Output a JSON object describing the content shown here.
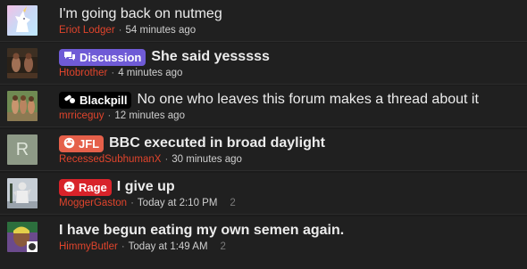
{
  "threads": [
    {
      "title": "I'm going back on nutmeg",
      "prefix": null,
      "author": "Eriot Lodger",
      "time": "54 minutes ago",
      "replies": null,
      "title_bold": false,
      "avatar_icon": "unicorn-avatar-icon"
    },
    {
      "title": "She said yesssss",
      "prefix": {
        "label": "Discussion",
        "icon": "chat-bubbles-icon",
        "color": "#6f5bd6"
      },
      "author": "Htobrother",
      "time": "4 minutes ago",
      "replies": null,
      "title_bold": true,
      "avatar_icon": "photo-avatar-icon"
    },
    {
      "title": "No one who leaves this forum makes a thread about it",
      "prefix": {
        "label": "Blackpill",
        "icon": "pills-icon",
        "color": "#000000"
      },
      "author": "mrriceguy",
      "time": "12 minutes ago",
      "replies": null,
      "title_bold": false,
      "avatar_icon": "photo-avatar-icon"
    },
    {
      "title": "BBC executed in broad daylight",
      "prefix": {
        "label": "JFL",
        "icon": "laugh-icon",
        "color": "#e5604a"
      },
      "author": "RecessedSubhumanX",
      "time": "30 minutes ago",
      "replies": null,
      "title_bold": true,
      "avatar_letter": "R",
      "avatar_icon": "letter-avatar-icon"
    },
    {
      "title": "I give up",
      "prefix": {
        "label": "Rage",
        "icon": "angry-face-icon",
        "color": "#d8232a"
      },
      "author": "MoggerGaston",
      "time": "Today at 2:10 PM",
      "replies": "2",
      "title_bold": true,
      "avatar_icon": "statue-avatar-icon"
    },
    {
      "title": "I have begun eating my own semen again.",
      "prefix": null,
      "author": "HimmyButler",
      "time": "Today at 1:49 AM",
      "replies": "2",
      "title_bold": true,
      "avatar_icon": "portrait-avatar-icon"
    }
  ],
  "colors": {
    "background": "#202020",
    "author": "#e0442c",
    "title": "#ececec"
  }
}
